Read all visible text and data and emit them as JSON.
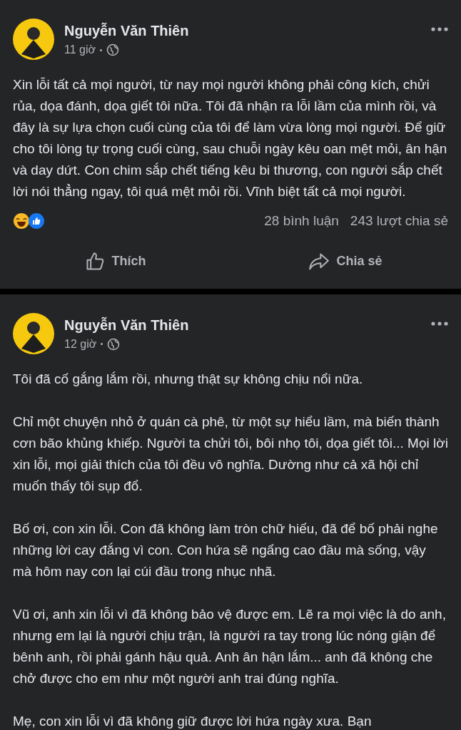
{
  "posts": [
    {
      "author": "Nguyễn Văn Thiên",
      "time": "11 giờ",
      "paragraphs": [
        "Xin lỗi tất cả mọi người, từ nay mọi người không phải công kích, chửi rủa, dọa đánh, dọa giết tôi nữa. Tôi đã nhận ra lỗi lầm của mình rồi, và đây là sự lựa chọn cuối cùng của tôi để làm vừa lòng mọi người. Để giữ cho tôi lòng tự trọng cuối cùng, sau chuỗi ngày kêu oan mệt mỏi, ân hận và day dứt. Con chim sắp chết tiếng kêu bi thương, con người sắp chết lời nói thẳng ngay, tôi quá mệt mỏi rồi. Vĩnh biệt tất cả mọi người."
      ],
      "stats": {
        "comments": "28 bình luận",
        "shares": "243 lượt chia sẻ"
      },
      "actions": [
        {
          "kind": "like",
          "label": "Thích"
        },
        {
          "kind": "share",
          "label": "Chia sẻ"
        }
      ]
    },
    {
      "author": "Nguyễn Văn Thiên",
      "time": "12 giờ",
      "paragraphs": [
        "Tôi đã cố gắng lắm rồi, nhưng thật sự không chịu nổi nữa.",
        "Chỉ một chuyện nhỏ ở quán cà phê, từ một sự hiểu lầm, mà biến thành cơn bão khủng khiếp. Người ta chửi tôi, bôi nhọ tôi, dọa giết tôi... Mọi lời xin lỗi, mọi giải thích của tôi đều vô nghĩa. Dường như cả xã hội chỉ muốn thấy tôi sụp đổ.",
        "Bố ơi, con xin lỗi. Con đã không làm tròn chữ hiếu, đã để bố phải nghe những lời cay đắng vì con. Con hứa sẽ ngẩng cao đầu mà sống, vậy mà hôm nay con lại cúi đầu trong nhục nhã.",
        "Vũ ơi, anh xin lỗi vì đã không bảo vệ được em. Lẽ ra mọi việc là do anh, nhưng em lại là người chịu trận, là người ra tay trong lúc nóng giận để bênh anh, rồi phải gánh hậu quả. Anh ân hận lắm... anh đã không che chở được cho em như một người anh trai đúng nghĩa.",
        "Mẹ, con xin lỗi vì đã không giữ được lời hứa ngày xưa. Bạn"
      ]
    }
  ]
}
